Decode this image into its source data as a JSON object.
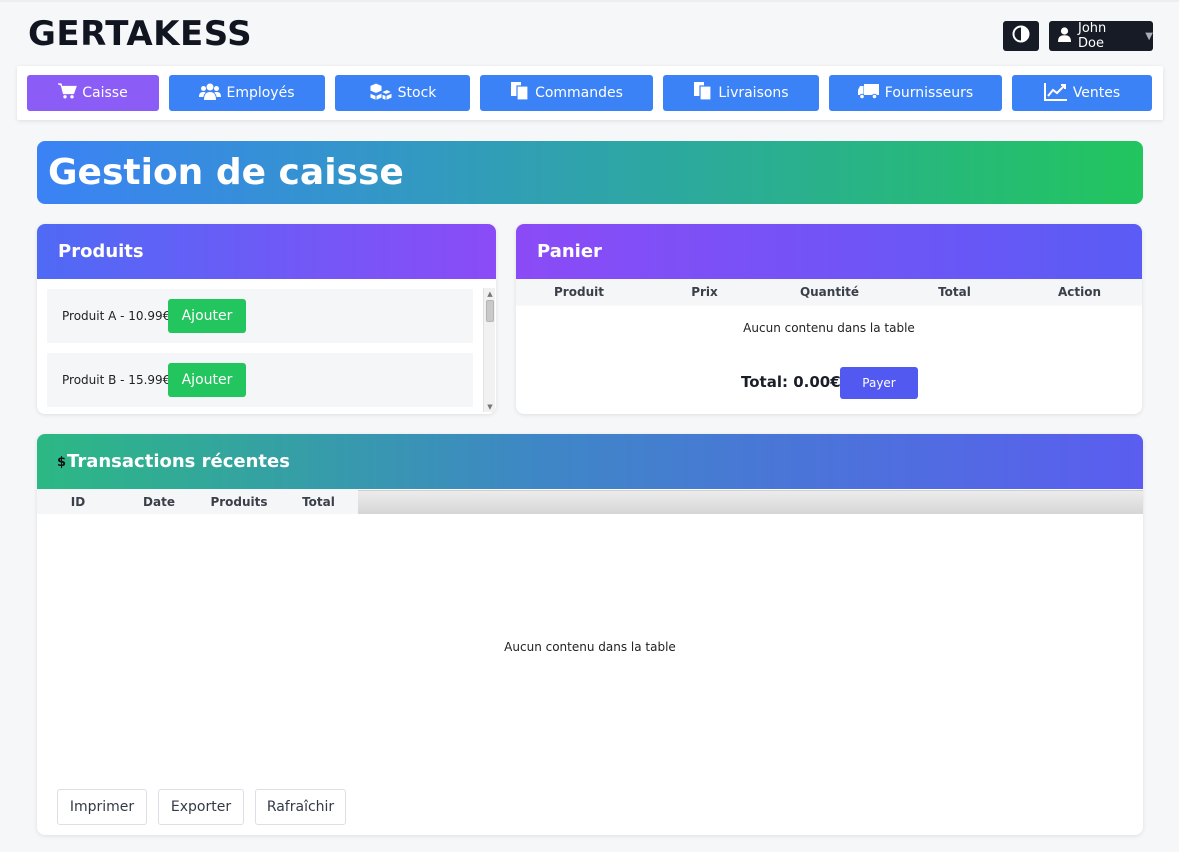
{
  "header": {
    "brand": "GERTAKESS",
    "theme_icon": "contrast-icon",
    "user": {
      "icon": "user-icon",
      "name": "John Doe",
      "caret_icon": "caret-down-icon"
    }
  },
  "nav": [
    {
      "label": "Caisse",
      "icon": "cart-icon",
      "active": true
    },
    {
      "label": "Employés",
      "icon": "users-icon"
    },
    {
      "label": "Stock",
      "icon": "cubes-icon"
    },
    {
      "label": "Commandes",
      "icon": "copy-icon"
    },
    {
      "label": "Livraisons",
      "icon": "copy-icon"
    },
    {
      "label": "Fournisseurs",
      "icon": "truck-icon"
    },
    {
      "label": "Ventes",
      "icon": "chart-line-icon"
    }
  ],
  "page": {
    "title": "Gestion de caisse"
  },
  "products": {
    "title": "Produits",
    "items": [
      {
        "label": "Produit A - 10.99€",
        "button": "Ajouter"
      },
      {
        "label": "Produit B - 15.99€",
        "button": "Ajouter"
      }
    ]
  },
  "cart": {
    "title": "Panier",
    "columns": [
      "Produit",
      "Prix",
      "Quantité",
      "Total",
      "Action"
    ],
    "empty": "Aucun contenu dans la table",
    "total_label": "Total: 0.00€",
    "pay_button": "Payer"
  },
  "transactions": {
    "icon_text": "$",
    "title": "Transactions récentes",
    "columns": [
      "ID",
      "Date",
      "Produits",
      "Total"
    ],
    "empty": "Aucun contenu dans la table",
    "buttons": [
      "Imprimer",
      "Exporter",
      "Rafraîchir"
    ]
  },
  "colors": {
    "nav_blue": "#3b82f6",
    "nav_active": "#8b5cf6",
    "success": "#22c55e",
    "pay": "#5159f0",
    "dark": "#161b26"
  }
}
